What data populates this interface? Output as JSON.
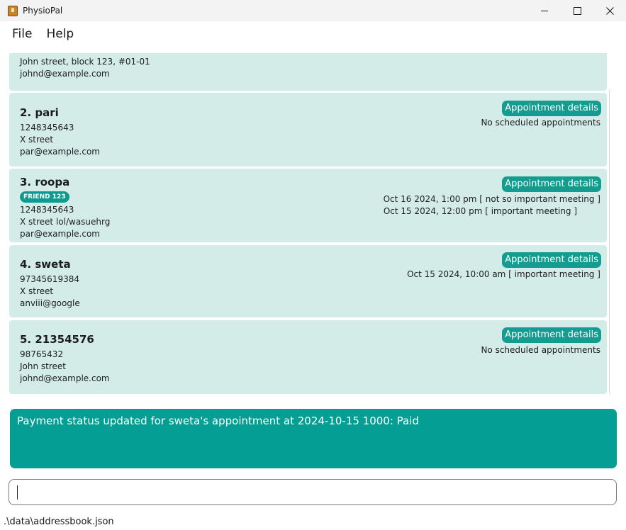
{
  "window": {
    "title": "PhysioPal",
    "minimize_icon": "minimize-icon",
    "maximize_icon": "maximize-icon",
    "close_icon": "close-icon"
  },
  "menu": {
    "items": [
      "File",
      "Help"
    ]
  },
  "persons": [
    {
      "partial_top_line": "",
      "address": "John street, block 123, #01-01",
      "email": "johnd@example.com"
    },
    {
      "name": "2. pari",
      "phone": "1248345643",
      "address": "X street",
      "email": "par@example.com",
      "appointment_button": "Appointment details",
      "appointments": [
        "No scheduled appointments"
      ]
    },
    {
      "name": "3. roopa",
      "tag": "FRIEND 123",
      "phone": "1248345643",
      "address": "X street lol/wasuehrg",
      "email": "par@example.com",
      "appointment_button": "Appointment details",
      "appointments": [
        "Oct 16 2024, 1:00 pm [ not so important meeting ]",
        "Oct 15 2024, 12:00 pm [ important meeting ]"
      ]
    },
    {
      "name": "4. sweta",
      "phone": "97345619384",
      "address": "X street",
      "email": "anviii@google",
      "appointment_button": "Appointment details",
      "appointments": [
        "Oct 15 2024, 10:00 am [ important meeting ]"
      ]
    },
    {
      "name": "5. 21354576",
      "phone": "98765432",
      "address": "John street",
      "email": "johnd@example.com",
      "appointment_button": "Appointment details",
      "appointments": [
        "No scheduled appointments"
      ]
    }
  ],
  "result": {
    "message": "Payment status updated for sweta's appointment at 2024-10-15 1000: Paid"
  },
  "command": {
    "value": "",
    "placeholder": ""
  },
  "status_bar": {
    "path": ".\\data\\addressbook.json"
  },
  "colors": {
    "card_background": "#d4ece8",
    "accent": "#149c90",
    "result_background": "#049e95"
  }
}
